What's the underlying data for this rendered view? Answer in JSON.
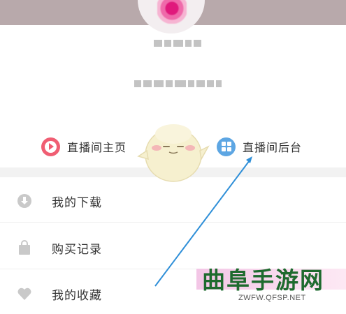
{
  "shortcuts": {
    "live_home": "直播间主页",
    "live_backend": "直播间后台"
  },
  "menu": {
    "items": [
      {
        "label": "我的下载",
        "icon": "download-icon"
      },
      {
        "label": "购买记录",
        "icon": "bag-icon"
      },
      {
        "label": "我的收藏",
        "icon": "heart-icon"
      }
    ]
  },
  "watermark": {
    "title": "曲阜手游网",
    "url": "ZWFW.QFSP.NET"
  },
  "colors": {
    "header": "#b8a9ab",
    "live_icon": "#f05e73",
    "admin_icon": "#5da6e3",
    "annotation_arrow": "#2f8fd8"
  }
}
